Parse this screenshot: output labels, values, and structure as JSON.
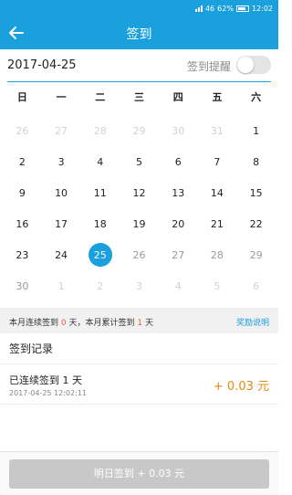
{
  "status_bar": {
    "network": "46",
    "battery": "62%",
    "time": "12:02"
  },
  "header": {
    "title": "签到"
  },
  "date_bar": {
    "date": "2017-04-25",
    "reminder_label": "签到提醒",
    "reminder_on": false
  },
  "calendar": {
    "weekdays": [
      "日",
      "一",
      "二",
      "三",
      "四",
      "五",
      "六"
    ],
    "days": [
      {
        "d": "26",
        "s": "off"
      },
      {
        "d": "27",
        "s": "off"
      },
      {
        "d": "28",
        "s": "off"
      },
      {
        "d": "29",
        "s": "off"
      },
      {
        "d": "30",
        "s": "off"
      },
      {
        "d": "31",
        "s": "off"
      },
      {
        "d": "1",
        "s": "past"
      },
      {
        "d": "2",
        "s": "past"
      },
      {
        "d": "3",
        "s": "past"
      },
      {
        "d": "4",
        "s": "past"
      },
      {
        "d": "5",
        "s": "past"
      },
      {
        "d": "6",
        "s": "past"
      },
      {
        "d": "7",
        "s": "past"
      },
      {
        "d": "8",
        "s": "past"
      },
      {
        "d": "9",
        "s": "past"
      },
      {
        "d": "10",
        "s": "past"
      },
      {
        "d": "11",
        "s": "past"
      },
      {
        "d": "12",
        "s": "past"
      },
      {
        "d": "13",
        "s": "past"
      },
      {
        "d": "14",
        "s": "past"
      },
      {
        "d": "15",
        "s": "past"
      },
      {
        "d": "16",
        "s": "past"
      },
      {
        "d": "17",
        "s": "past"
      },
      {
        "d": "18",
        "s": "past"
      },
      {
        "d": "19",
        "s": "past"
      },
      {
        "d": "20",
        "s": "past"
      },
      {
        "d": "21",
        "s": "past"
      },
      {
        "d": "22",
        "s": "past"
      },
      {
        "d": "23",
        "s": "past"
      },
      {
        "d": "24",
        "s": "past"
      },
      {
        "d": "25",
        "s": "today"
      },
      {
        "d": "26",
        "s": "future"
      },
      {
        "d": "27",
        "s": "future"
      },
      {
        "d": "28",
        "s": "future"
      },
      {
        "d": "29",
        "s": "future"
      },
      {
        "d": "30",
        "s": "future"
      },
      {
        "d": "1",
        "s": "off"
      },
      {
        "d": "2",
        "s": "off"
      },
      {
        "d": "3",
        "s": "off"
      },
      {
        "d": "4",
        "s": "off"
      },
      {
        "d": "5",
        "s": "off"
      },
      {
        "d": "6",
        "s": "off"
      }
    ]
  },
  "summary": {
    "streak_prefix": "本月连续签到 ",
    "streak_count": "0",
    "streak_mid": " 天，本月累计签到 ",
    "total_count": "1",
    "total_suffix": " 天",
    "rules_link": "奖励说明"
  },
  "records": {
    "title": "签到记录",
    "items": [
      {
        "label": "已连续签到 1 天",
        "time": "2017-04-25 12:02:11",
        "amount": "+ 0.03 元"
      }
    ]
  },
  "footer": {
    "button_label": "明日签到 + 0.03 元"
  },
  "colors": {
    "primary": "#1aa0dc",
    "highlight": "#ee5a3a",
    "reward": "#e48a0e",
    "disabled": "#c8c8c8"
  }
}
